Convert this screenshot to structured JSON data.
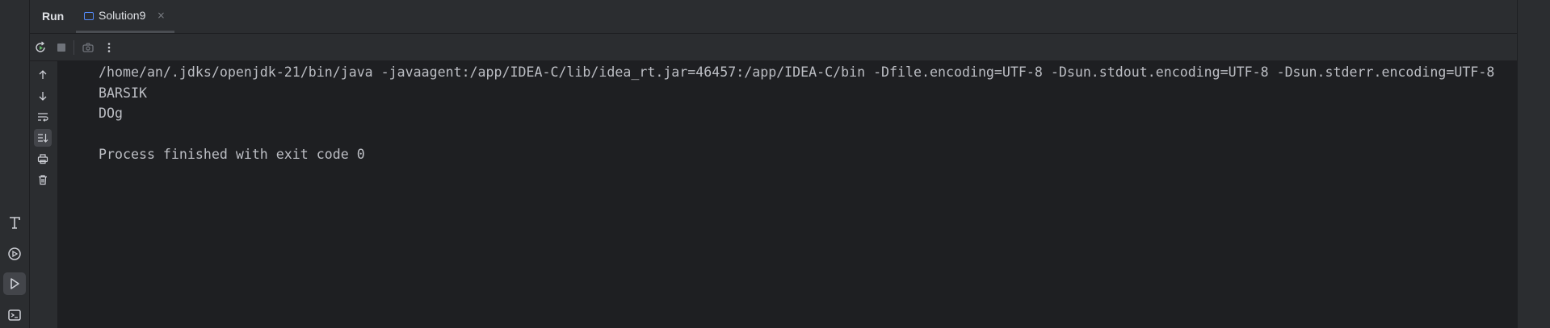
{
  "tool_window": {
    "title": "Run",
    "tab": {
      "label": "Solution9",
      "close_glyph": "×",
      "icon": "application-run-config-icon"
    }
  },
  "toolbar": {
    "buttons": [
      {
        "name": "rerun-icon"
      },
      {
        "name": "stop-icon"
      },
      {
        "name": "camera-icon"
      },
      {
        "name": "more-options-icon"
      }
    ]
  },
  "gutter": {
    "buttons": [
      {
        "name": "arrow-up-icon"
      },
      {
        "name": "arrow-down-icon"
      },
      {
        "name": "soft-wrap-icon"
      },
      {
        "name": "scroll-to-end-icon",
        "toggled": true
      },
      {
        "name": "print-icon"
      },
      {
        "name": "trash-icon"
      }
    ]
  },
  "left_stripe": {
    "buttons": [
      {
        "name": "text-format-icon"
      },
      {
        "name": "services-icon"
      },
      {
        "name": "run-icon",
        "active": true
      },
      {
        "name": "terminal-icon"
      }
    ]
  },
  "console": {
    "lines": [
      "/home/an/.jdks/openjdk-21/bin/java -javaagent:/app/IDEA-C/lib/idea_rt.jar=46457:/app/IDEA-C/bin -Dfile.encoding=UTF-8 -Dsun.stdout.encoding=UTF-8 -Dsun.stderr.encoding=UTF-8",
      "BARSIK",
      "DOg",
      "",
      "Process finished with exit code 0"
    ]
  },
  "colors": {
    "background": "#1e1f22",
    "panel": "#2b2d30",
    "text": "#bcbec4",
    "accent": "#548af7",
    "rerun_green": "#5fb865"
  }
}
